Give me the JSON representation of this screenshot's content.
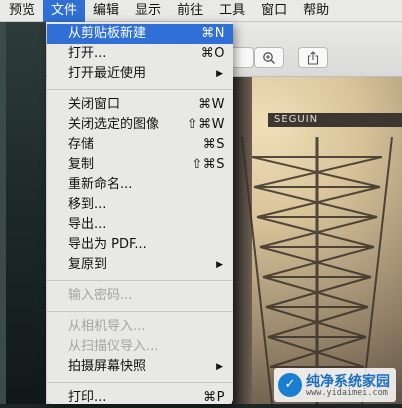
{
  "menubar": {
    "items": [
      {
        "label": "预览"
      },
      {
        "label": "文件"
      },
      {
        "label": "编辑"
      },
      {
        "label": "显示"
      },
      {
        "label": "前往"
      },
      {
        "label": "工具"
      },
      {
        "label": "窗口"
      },
      {
        "label": "帮助"
      }
    ],
    "active_index": 1
  },
  "file_menu": {
    "group1": [
      {
        "label": "从剪贴板新建",
        "shortcut": "⌘N"
      },
      {
        "label": "打开...",
        "shortcut": "⌘O"
      },
      {
        "label": "打开最近使用",
        "shortcut": ""
      }
    ],
    "group2": [
      {
        "label": "关闭窗口",
        "shortcut": "⌘W"
      },
      {
        "label": "关闭选定的图像",
        "shortcut": "⇧⌘W"
      },
      {
        "label": "存储",
        "shortcut": "⌘S"
      },
      {
        "label": "复制",
        "shortcut": "⇧⌘S"
      },
      {
        "label": "重新命名...",
        "shortcut": ""
      },
      {
        "label": "移到...",
        "shortcut": ""
      },
      {
        "label": "导出...",
        "shortcut": ""
      },
      {
        "label": "导出为 PDF...",
        "shortcut": ""
      },
      {
        "label": "复原到",
        "shortcut": ""
      }
    ],
    "group3": [
      {
        "label": "输入密码...",
        "shortcut": ""
      }
    ],
    "group4": [
      {
        "label": "从相机导入...",
        "shortcut": ""
      },
      {
        "label": "从扫描仪导入...",
        "shortcut": ""
      },
      {
        "label": "拍摄屏幕快照",
        "shortcut": ""
      }
    ],
    "group5": [
      {
        "label": "打印...",
        "shortcut": "⌘P"
      }
    ]
  },
  "photo": {
    "sign_text": "SEGUIN"
  },
  "watermark": {
    "title": "纯净系统家园",
    "url": "www.yidaimei.com"
  },
  "colors": {
    "menu_highlight": "#2f6fd6",
    "menubar_bg": "#e9e9e7",
    "menu_bg": "#e8e8e6",
    "disabled_text": "#a4a4a4"
  }
}
